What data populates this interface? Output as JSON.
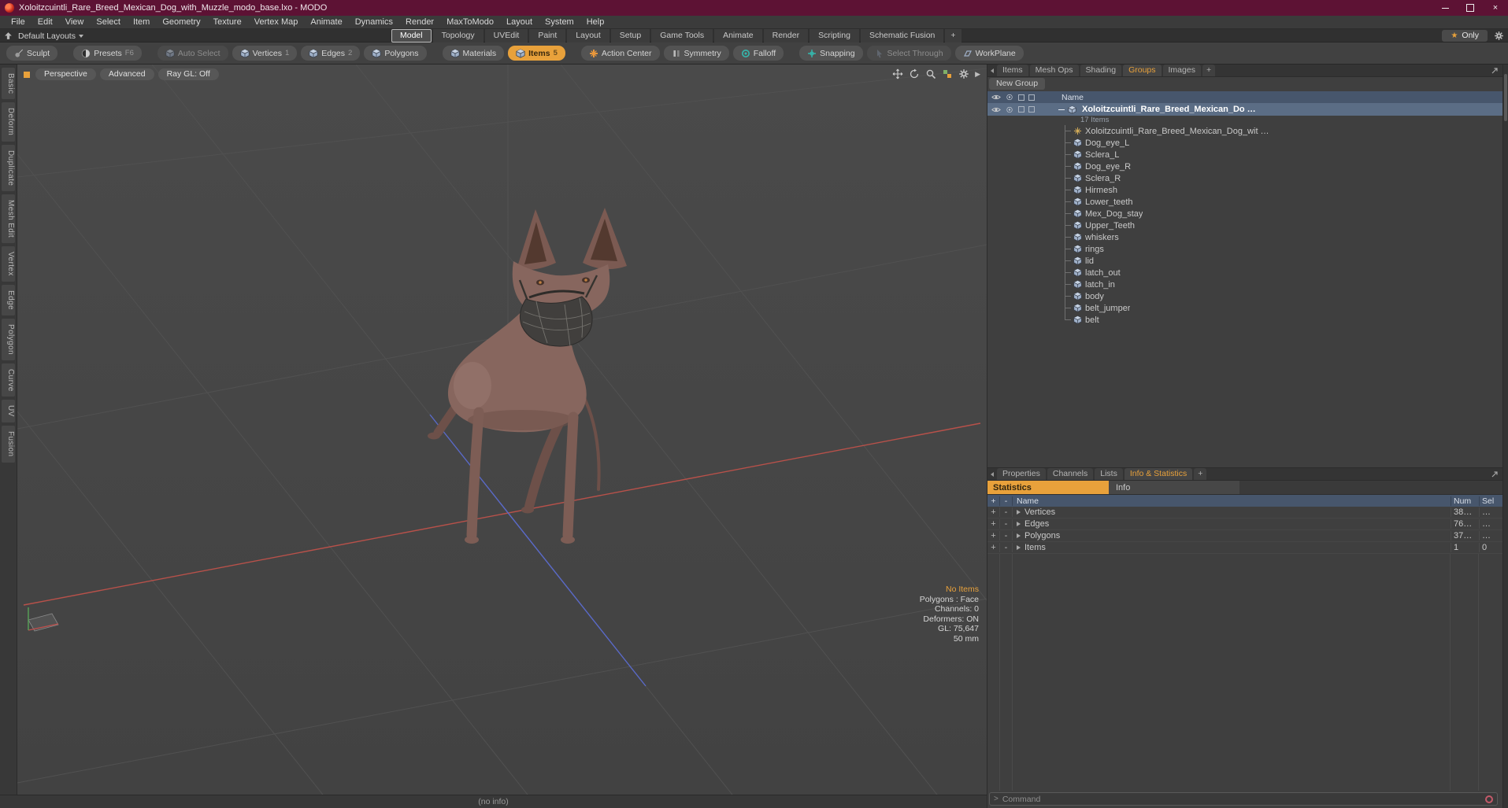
{
  "titlebar": {
    "title": "Xoloitzcuintli_Rare_Breed_Mexican_Dog_with_Muzzle_modo_base.lxo - MODO"
  },
  "icons": {
    "star": "★",
    "close": "×",
    "play": "▶",
    "plus": "+",
    "minus": "-"
  },
  "menu": {
    "items": [
      "File",
      "Edit",
      "View",
      "Select",
      "Item",
      "Geometry",
      "Texture",
      "Vertex Map",
      "Animate",
      "Dynamics",
      "Render",
      "MaxToModo",
      "Layout",
      "System",
      "Help"
    ]
  },
  "layout_bar": {
    "default_layouts": "Default Layouts",
    "tabs": [
      "Model",
      "Topology",
      "UVEdit",
      "Paint",
      "Layout",
      "Setup",
      "Game Tools",
      "Animate",
      "Render",
      "Scripting",
      "Schematic Fusion",
      "+"
    ],
    "only": "Only"
  },
  "toolbar": {
    "buttons": [
      {
        "label": "Sculpt"
      },
      {
        "label": "Presets",
        "key": "F6"
      },
      {
        "label": "Auto Select"
      },
      {
        "label": "Vertices",
        "key": "1"
      },
      {
        "label": "Edges",
        "key": "2"
      },
      {
        "label": "Polygons"
      },
      {
        "label": "Materials"
      },
      {
        "label": "Items",
        "key": "5"
      },
      {
        "label": "Action Center"
      },
      {
        "label": "Symmetry"
      },
      {
        "label": "Falloff"
      },
      {
        "label": "Snapping"
      },
      {
        "label": "Select Through"
      },
      {
        "label": "WorkPlane"
      }
    ]
  },
  "side_tabs": {
    "items": [
      "Basic",
      "Deform",
      "Duplicate",
      "Mesh Edit",
      "Vertex",
      "Edge",
      "Polygon",
      "Curve",
      "UV",
      "Fusion"
    ]
  },
  "viewport": {
    "buttons": [
      "Perspective",
      "Advanced",
      "Ray GL: Off"
    ],
    "hud": [
      "No Items",
      "Polygons : Face",
      "Channels: 0",
      "Deformers: ON",
      "GL: 75,647",
      "50 mm"
    ]
  },
  "groups_panel": {
    "tabs": [
      "Items",
      "Mesh Ops",
      "Shading",
      "Groups",
      "Images",
      "+"
    ],
    "new_group": "New Group",
    "name_header": "Name",
    "group_label": "Xoloitzcuintli_Rare_Breed_Mexican_Do …",
    "group_count": "17 Items",
    "items": [
      "Xoloitzcuintli_Rare_Breed_Mexican_Dog_wit …",
      "Dog_eye_L",
      "Sclera_L",
      "Dog_eye_R",
      "Sclera_R",
      "Hirmesh",
      "Lower_teeth",
      "Mex_Dog_stay",
      "Upper_Teeth",
      "whiskers",
      "rings",
      "lid",
      "latch_out",
      "latch_in",
      "body",
      "belt_jumper",
      "belt"
    ]
  },
  "stats_panel": {
    "tabs": [
      "Properties",
      "Channels",
      "Lists",
      "Info & Statistics",
      "+"
    ],
    "subtabs": [
      "Statistics",
      "Info"
    ],
    "columns": [
      "+",
      "-",
      "Name",
      "Num",
      "Sel"
    ],
    "rows": [
      {
        "name": "Vertices",
        "num": "38…",
        "sel": "…"
      },
      {
        "name": "Edges",
        "num": "76…",
        "sel": "…"
      },
      {
        "name": "Polygons",
        "num": "37…",
        "sel": "…"
      },
      {
        "name": "Items",
        "num": "1",
        "sel": "0"
      }
    ]
  },
  "command": {
    "prompt": ">",
    "placeholder": "Command"
  },
  "status": "(no info)",
  "colors": {
    "accent": "#E8A13B",
    "titlebar": "#5D1234",
    "axis_red": "#B8514A",
    "axis_blue": "#5A6AC8",
    "viewport_bg": "#464646"
  }
}
